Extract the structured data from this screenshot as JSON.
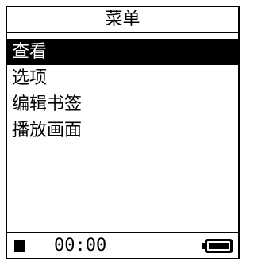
{
  "title": "菜单",
  "menu": {
    "items": [
      {
        "label": "查看",
        "selected": true
      },
      {
        "label": "选项",
        "selected": false
      },
      {
        "label": "编辑书签",
        "selected": false
      },
      {
        "label": "播放画面",
        "selected": false
      }
    ]
  },
  "status": {
    "time": "00:00",
    "playback_icon": "stop-icon",
    "battery_icon": "battery-icon",
    "battery_level": 1.0
  },
  "colors": {
    "foreground": "#000000",
    "background": "#ffffff",
    "selection": "#000000"
  }
}
